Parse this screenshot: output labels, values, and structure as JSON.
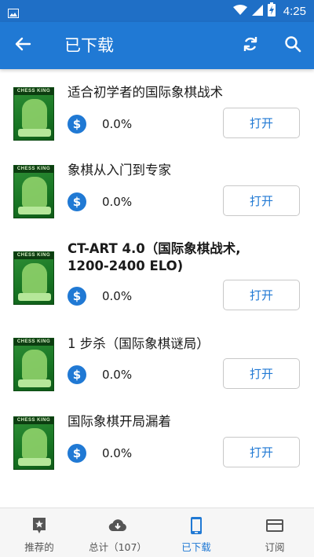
{
  "status_bar": {
    "time": "4:25",
    "icons": [
      "image-icon",
      "wifi-icon",
      "signal-icon",
      "battery-charging-icon"
    ]
  },
  "app_bar": {
    "title": "已下载",
    "icons": [
      "back-arrow-icon",
      "sync-icon",
      "search-icon"
    ]
  },
  "colors": {
    "primary": "#2079d4",
    "status_bar": "#1f6fc6",
    "cover_green": "#177523"
  },
  "downloads": [
    {
      "title": "适合初学者的国际象棋战术",
      "cover_text": "CHESS KING",
      "price_icon": "dollar-icon",
      "progress": "0.0%",
      "open_label": "打开"
    },
    {
      "title": "象棋从入门到专家",
      "cover_text": "CHESS KING",
      "price_icon": "dollar-icon",
      "progress": "0.0%",
      "open_label": "打开"
    },
    {
      "title": "CT-ART 4.0（国际象棋战术, 1200-2400 ELO)",
      "cover_text": "CHESS KING",
      "price_icon": "dollar-icon",
      "progress": "0.0%",
      "open_label": "打开"
    },
    {
      "title": "1 步杀（国际象棋谜局）",
      "cover_text": "CHESS KING",
      "price_icon": "dollar-icon",
      "progress": "0.0%",
      "open_label": "打开"
    },
    {
      "title": "国际象棋开局漏着",
      "cover_text": "CHESS KING",
      "price_icon": "dollar-icon",
      "progress": "0.0%",
      "open_label": "打开"
    }
  ],
  "bottom_nav": [
    {
      "label": "推荐的",
      "icon": "star-badge-icon",
      "active": false
    },
    {
      "label": "总计（107）",
      "icon": "cloud-download-icon",
      "active": false
    },
    {
      "label": "已下载",
      "icon": "phone-icon",
      "active": true
    },
    {
      "label": "订阅",
      "icon": "card-icon",
      "active": false
    }
  ]
}
